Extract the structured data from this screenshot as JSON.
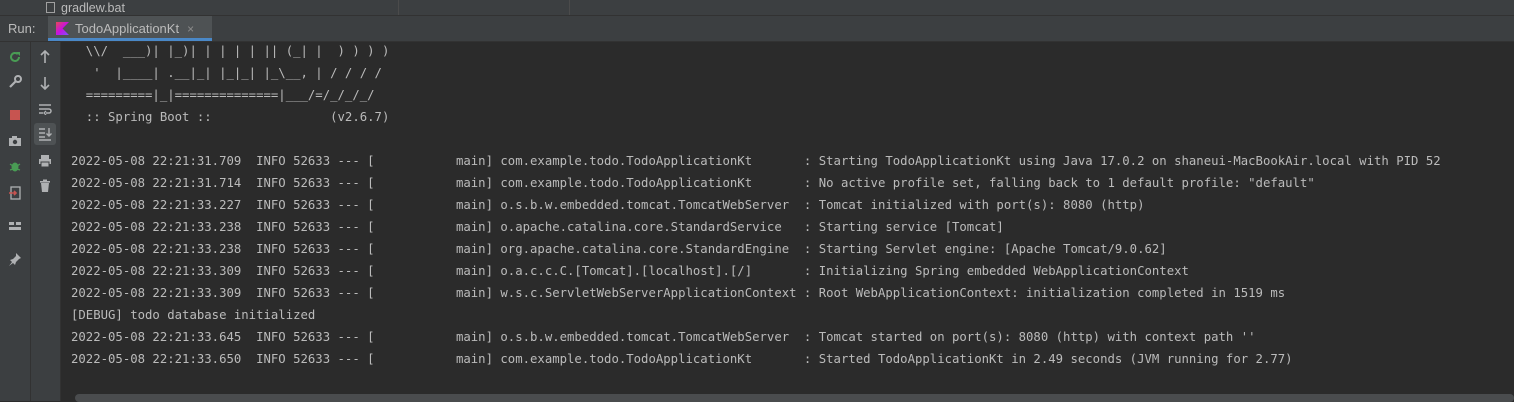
{
  "project_tree": {
    "visible_file": "gradlew.bat"
  },
  "run_bar": {
    "label": "Run:",
    "tab": "TodoApplicationKt",
    "close": "×"
  },
  "toolbar": {
    "col1": [
      "rerun-icon",
      "wrench-icon",
      "stop-icon",
      "camera-icon",
      "debug-bug-icon",
      "exit-icon",
      "layout-icon",
      "pin-icon"
    ],
    "col2": [
      "arrow-up-icon",
      "arrow-down-icon",
      "soft-wrap-icon",
      "scroll-to-end-icon",
      "print-icon",
      "trash-icon"
    ]
  },
  "console": {
    "lines": [
      "  \\\\/  ___)| |_)| | | | | || (_| |  ) ) ) )",
      "   '  |____| .__|_| |_|_| |_\\__, | / / / /",
      "  =========|_|==============|___/=/_/_/_/",
      "  :: Spring Boot ::                (v2.6.7)",
      "",
      "2022-05-08 22:21:31.709  INFO 52633 --- [           main] com.example.todo.TodoApplicationKt       : Starting TodoApplicationKt using Java 17.0.2 on shaneui-MacBookAir.local with PID 52",
      "2022-05-08 22:21:31.714  INFO 52633 --- [           main] com.example.todo.TodoApplicationKt       : No active profile set, falling back to 1 default profile: \"default\"",
      "2022-05-08 22:21:33.227  INFO 52633 --- [           main] o.s.b.w.embedded.tomcat.TomcatWebServer  : Tomcat initialized with port(s): 8080 (http)",
      "2022-05-08 22:21:33.238  INFO 52633 --- [           main] o.apache.catalina.core.StandardService   : Starting service [Tomcat]",
      "2022-05-08 22:21:33.238  INFO 52633 --- [           main] org.apache.catalina.core.StandardEngine  : Starting Servlet engine: [Apache Tomcat/9.0.62]",
      "2022-05-08 22:21:33.309  INFO 52633 --- [           main] o.a.c.c.C.[Tomcat].[localhost].[/]       : Initializing Spring embedded WebApplicationContext",
      "2022-05-08 22:21:33.309  INFO 52633 --- [           main] w.s.c.ServletWebServerApplicationContext : Root WebApplicationContext: initialization completed in 1519 ms",
      "[DEBUG] todo database initialized",
      "2022-05-08 22:21:33.645  INFO 52633 --- [           main] o.s.b.w.embedded.tomcat.TomcatWebServer  : Tomcat started on port(s): 8080 (http) with context path ''",
      "2022-05-08 22:21:33.650  INFO 52633 --- [           main] com.example.todo.TodoApplicationKt       : Started TodoApplicationKt in 2.49 seconds (JVM running for 2.77)"
    ]
  },
  "colors": {
    "background": "#2b2b2b",
    "panel": "#3c3f41",
    "text": "#bbbbbb",
    "accent": "#4a88c7"
  }
}
